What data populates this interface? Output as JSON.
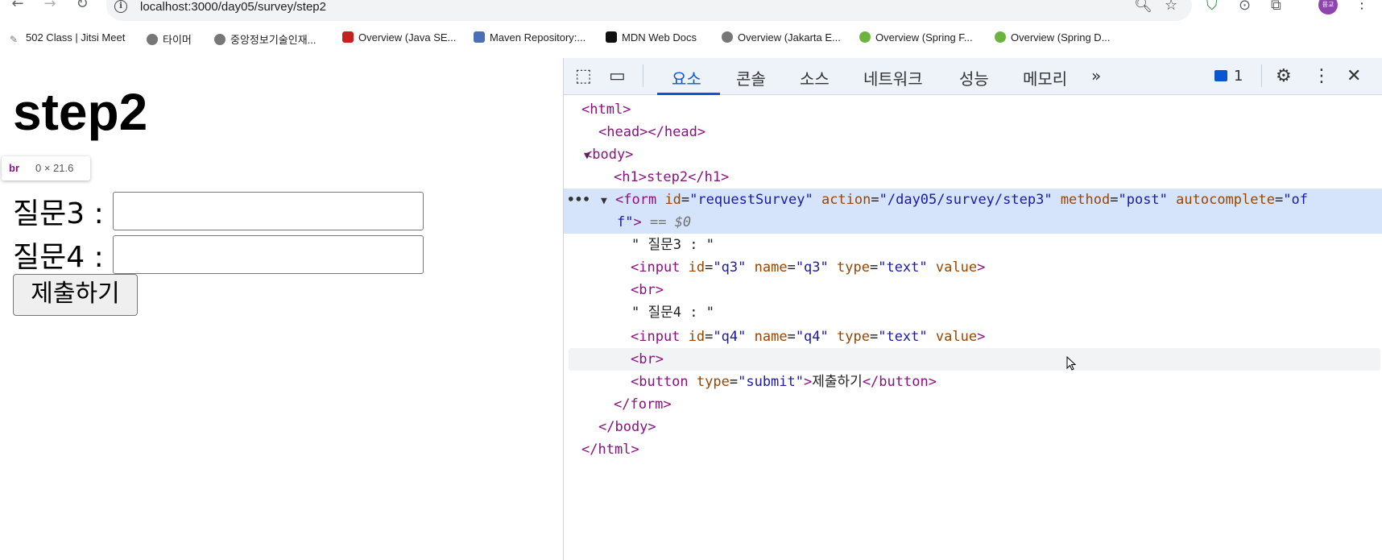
{
  "browser": {
    "url": "localhost:3000/day05/survey/step2",
    "bookmarks": [
      {
        "label": "502 Class | Jitsi Meet",
        "icon": "pen-icon"
      },
      {
        "label": "타이머",
        "icon": "globe-icon"
      },
      {
        "label": "중앙정보기술인재...",
        "icon": "globe-icon"
      },
      {
        "label": "Overview (Java SE...",
        "icon": "oracle-icon"
      },
      {
        "label": "Maven Repository:...",
        "icon": "maven-icon"
      },
      {
        "label": "MDN Web Docs",
        "icon": "mdn-icon"
      },
      {
        "label": "Overview (Jakarta E...",
        "icon": "globe-icon"
      },
      {
        "label": "Overview (Spring F...",
        "icon": "spring-icon"
      },
      {
        "label": "Overview (Spring D...",
        "icon": "spring-icon"
      }
    ],
    "avatar_text": "용교"
  },
  "page": {
    "heading": "step2",
    "tooltip": {
      "tag": "br",
      "dims": "0 × 21.6"
    },
    "q3_label": "질문3 :",
    "q4_label": "질문4 :",
    "q3_value": "",
    "q4_value": "",
    "submit_label": "제출하기"
  },
  "devtools": {
    "tabs": [
      "요소",
      "콘솔",
      "소스",
      "네트워크",
      "성능",
      "메모리"
    ],
    "active_tab": "요소",
    "more_tabs": "»",
    "issues_count": "1",
    "tree": {
      "l1": "<html>",
      "l2": "<head></head>",
      "l3": "<body>",
      "l4": "<h1>step2</h1>",
      "form_open": "<form",
      "form_attr1_name": "id",
      "form_attr1_val": "\"requestSurvey\"",
      "form_attr2_name": "action",
      "form_attr2_val": "\"/day05/survey/step3\"",
      "form_attr3_name": "method",
      "form_attr3_val": "\"post\"",
      "form_attr4_name": "autocomplete",
      "form_attr4_val_a": "\"of",
      "form_attr4_val_b": "f\"",
      "form_close_bracket": ">",
      "eq0": "== $0",
      "t1": "\" 질문3 : \"",
      "in1_open": "<input",
      "in1_id": "\"q3\"",
      "in1_name": "\"q3\"",
      "in1_type": "\"text\"",
      "br": "<br>",
      "t2": "\" 질문4 : \"",
      "in2_id": "\"q4\"",
      "in2_name": "\"q4\"",
      "in2_type": "\"text\"",
      "btn_open": "<button",
      "btn_type": "\"submit\"",
      "btn_text": "제출하기",
      "btn_close": "</button>",
      "form_end": "</form>",
      "body_end": "</body>",
      "html_end": "</html>",
      "attr_id": "id",
      "attr_name": "name",
      "attr_type": "type",
      "attr_value": "value"
    }
  }
}
